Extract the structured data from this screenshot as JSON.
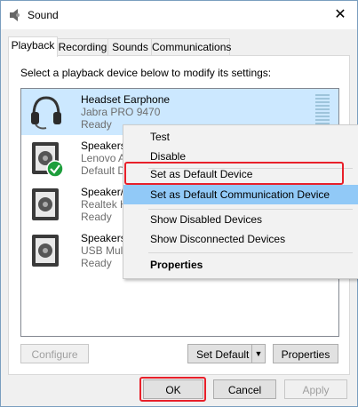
{
  "window": {
    "title": "Sound",
    "close_glyph": "✕"
  },
  "tabs": [
    {
      "label": "Playback",
      "active": true
    },
    {
      "label": "Recording"
    },
    {
      "label": "Sounds"
    },
    {
      "label": "Communications"
    }
  ],
  "instruction": "Select a playback device below to modify its settings:",
  "devices": [
    {
      "name": "Headset Earphone",
      "sub": "Jabra PRO 9470",
      "status": "Ready",
      "icon": "headset-icon",
      "selected": true
    },
    {
      "name": "Speakers",
      "sub": "Lenovo A",
      "status": "Default D",
      "icon": "speaker-icon",
      "default_check": true
    },
    {
      "name": "Speaker/",
      "sub": "Realtek H",
      "status": "Ready",
      "icon": "speaker-icon"
    },
    {
      "name": "Speakers",
      "sub": "USB Mul",
      "status": "Ready",
      "icon": "speaker-icon"
    }
  ],
  "context_menu": {
    "items": [
      {
        "label": "Test"
      },
      {
        "label": "Disable"
      },
      {
        "label": "Set as Default Device",
        "highlighted_box": true
      },
      {
        "label": "Set as Default Communication Device",
        "hover": true
      },
      {
        "label": "Show Disabled Devices"
      },
      {
        "label": "Show Disconnected Devices"
      },
      {
        "label": "Properties",
        "bold": true
      }
    ]
  },
  "panel_buttons": {
    "configure": "Configure",
    "set_default": "Set Default",
    "set_default_arrow": "▼",
    "properties": "Properties"
  },
  "footer_buttons": {
    "ok": "OK",
    "cancel": "Cancel",
    "apply": "Apply"
  },
  "colors": {
    "selection": "#cce8ff",
    "menu_hover": "#91c9f7",
    "annotation_red": "#e8202a",
    "default_check_green": "#1e9e3c"
  }
}
